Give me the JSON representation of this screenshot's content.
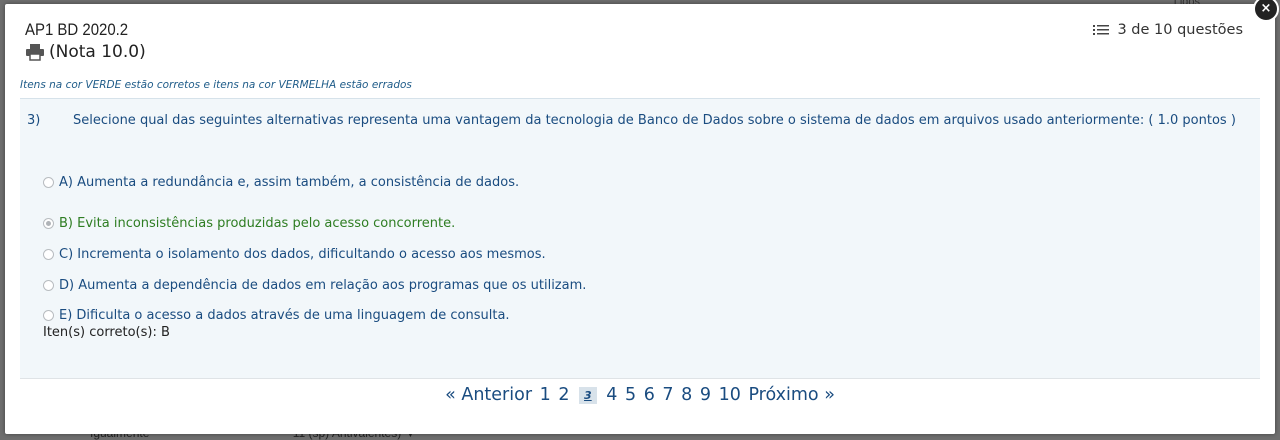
{
  "background": {
    "peek_top": "Lidos",
    "peek_bottom_left": "Igualmente",
    "peek_bottom_right": "11 (sp) Antivalentes) ▼"
  },
  "modal": {
    "close_label": "×",
    "title": "AP1 BD 2020.2",
    "grade": "(Nota 10.0)",
    "counter": "3 de 10 questões",
    "legend": "Itens na cor VERDE estão corretos e itens na cor VERMELHA estão errados"
  },
  "question": {
    "number": "3)",
    "text": "Selecione qual das seguintes alternativas representa uma vantagem da tecnologia de Banco de Dados sobre o sistema de dados em arquivos usado anteriormente: ( 1.0 pontos )",
    "options": [
      {
        "label": "A) Aumenta a redundância e, assim também, a consistência de dados.",
        "selected": false,
        "correct": false
      },
      {
        "label": "B) Evita inconsistências produzidas pelo acesso concorrente.",
        "selected": true,
        "correct": true
      },
      {
        "label": "C) Incrementa o isolamento dos dados, dificultando o acesso aos mesmos.",
        "selected": false,
        "correct": false
      },
      {
        "label": "D) Aumenta a dependência de dados em relação aos programas que os utilizam.",
        "selected": false,
        "correct": false
      },
      {
        "label": "E) Dificulta o acesso a dados através de uma linguagem de consulta.",
        "selected": false,
        "correct": false
      }
    ],
    "answer_key": "Iten(s) correto(s): B"
  },
  "pagination": {
    "prev_label": "« Anterior",
    "pages": [
      "1",
      "2",
      "3",
      "4",
      "5",
      "6",
      "7",
      "8",
      "9",
      "10"
    ],
    "current": "3",
    "next_label": "Próximo »"
  },
  "colors": {
    "link_blue": "#1a4c80",
    "correct_green": "#2e7d22",
    "area_bg": "#f2f7fa"
  },
  "icons": {
    "print": "printer-icon",
    "counter": "list-icon",
    "close": "close-icon"
  }
}
